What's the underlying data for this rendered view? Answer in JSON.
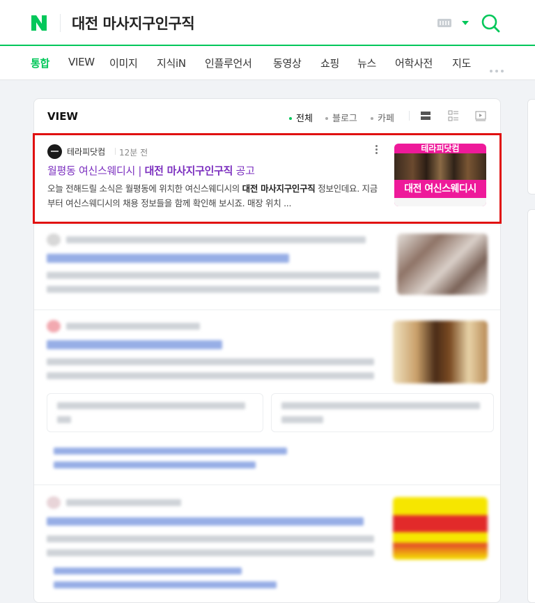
{
  "header": {
    "logo_letter": "N",
    "query": "대전 마사지구인구직",
    "brand_color": "#03c75a"
  },
  "tabs": [
    "통합",
    "VIEW",
    "이미지",
    "지식iN",
    "인플루언서",
    "동영상",
    "쇼핑",
    "뉴스",
    "어학사전",
    "지도"
  ],
  "view_section": {
    "title": "VIEW",
    "filters": [
      "전체",
      "블로그",
      "카페"
    ],
    "active_filter": "전체"
  },
  "result1": {
    "source": "테라피닷컴",
    "time": "12분 전",
    "title_plain": "월평동 여신스웨디시 | ",
    "title_bold": "대전 마사지구인구직",
    "title_tail": " 공고",
    "desc_1": "오늘 전해드릴 소식은 월평동에 위치한 여신스웨디시의 ",
    "desc_bold": "대전 마사지구인구직",
    "desc_2": " 정보인데요. 지금부터 여신스웨디시의 채용 정보들을 함께 확인해 보시죠. 매장 위치 ...",
    "thumb_top": "테라피닷컴",
    "thumb_bottom": "대전 여신스웨디시"
  }
}
